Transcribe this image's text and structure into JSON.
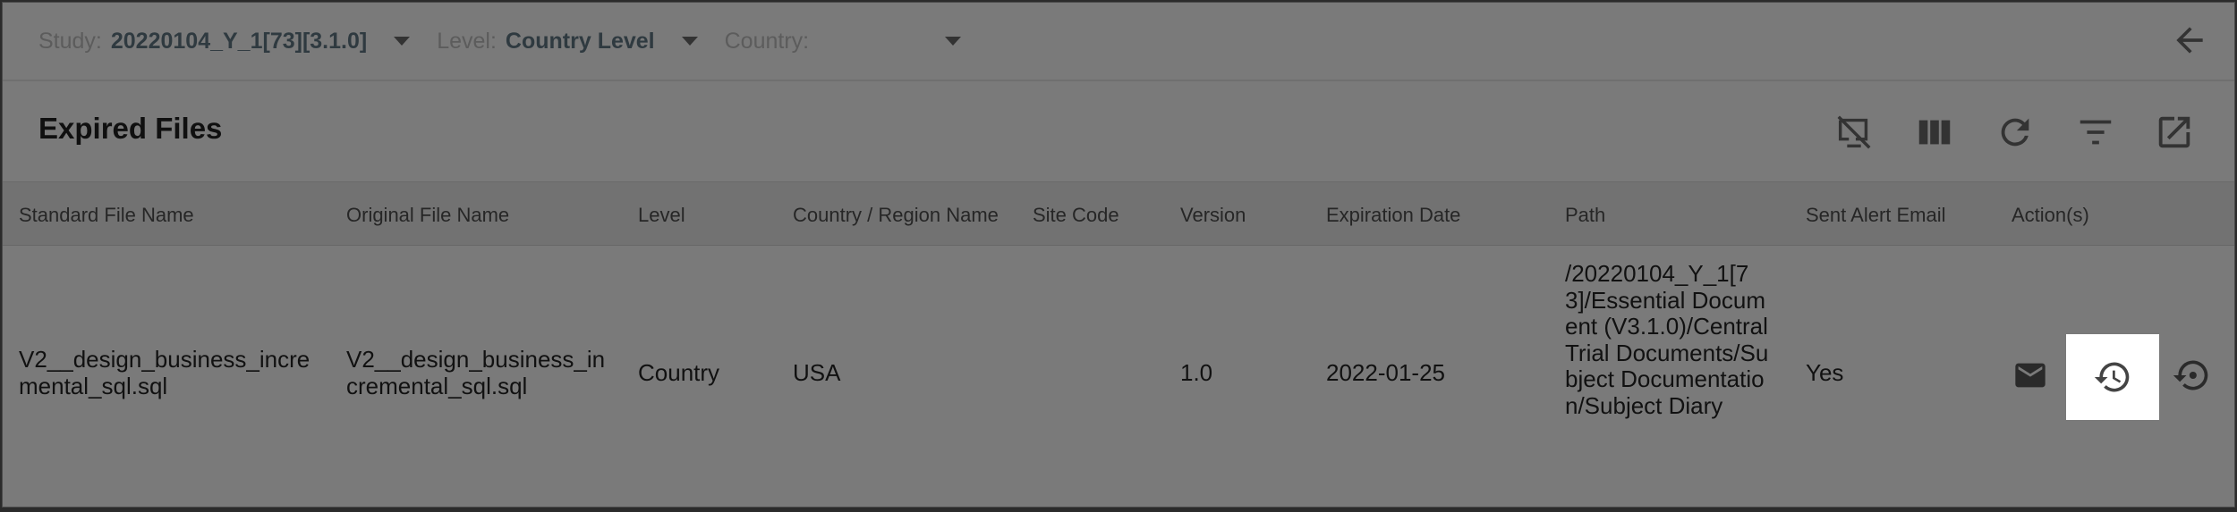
{
  "filters": {
    "study_label": "Study:",
    "study_value": "20220104_Y_1[73][3.1.0]",
    "level_label": "Level:",
    "level_value": "Country Level",
    "country_label": "Country:",
    "country_value": ""
  },
  "page": {
    "title": "Expired Files"
  },
  "toolbar_icons": [
    "hide-display-icon",
    "columns-icon",
    "refresh-icon",
    "filter-icon",
    "export-icon"
  ],
  "table": {
    "columns": [
      "Standard File Name",
      "Original File Name",
      "Level",
      "Country / Region Name",
      "Site Code",
      "Version",
      "Expiration Date",
      "Path",
      "Sent Alert Email",
      "Action(s)"
    ],
    "rows": [
      {
        "standard_file_name": "V2__design_business_incremental_sql.sql",
        "original_file_name": "V2__design_business_incremental_sql.sql",
        "level": "Country",
        "country_region": "USA",
        "site_code": "",
        "version": "1.0",
        "expiration_date": "2022-01-25",
        "path": "/20220104_Y_1[73]/Essential Document (V3.1.0)/Central Trial Documents/Subject Documentation/Subject Diary",
        "sent_alert_email": "Yes",
        "actions": [
          "email-icon",
          "history-icon",
          "restore-icon"
        ]
      }
    ]
  },
  "colors": {
    "overlay": "#7a7a7a",
    "highlight": "#ffffff",
    "text": "#111111"
  }
}
